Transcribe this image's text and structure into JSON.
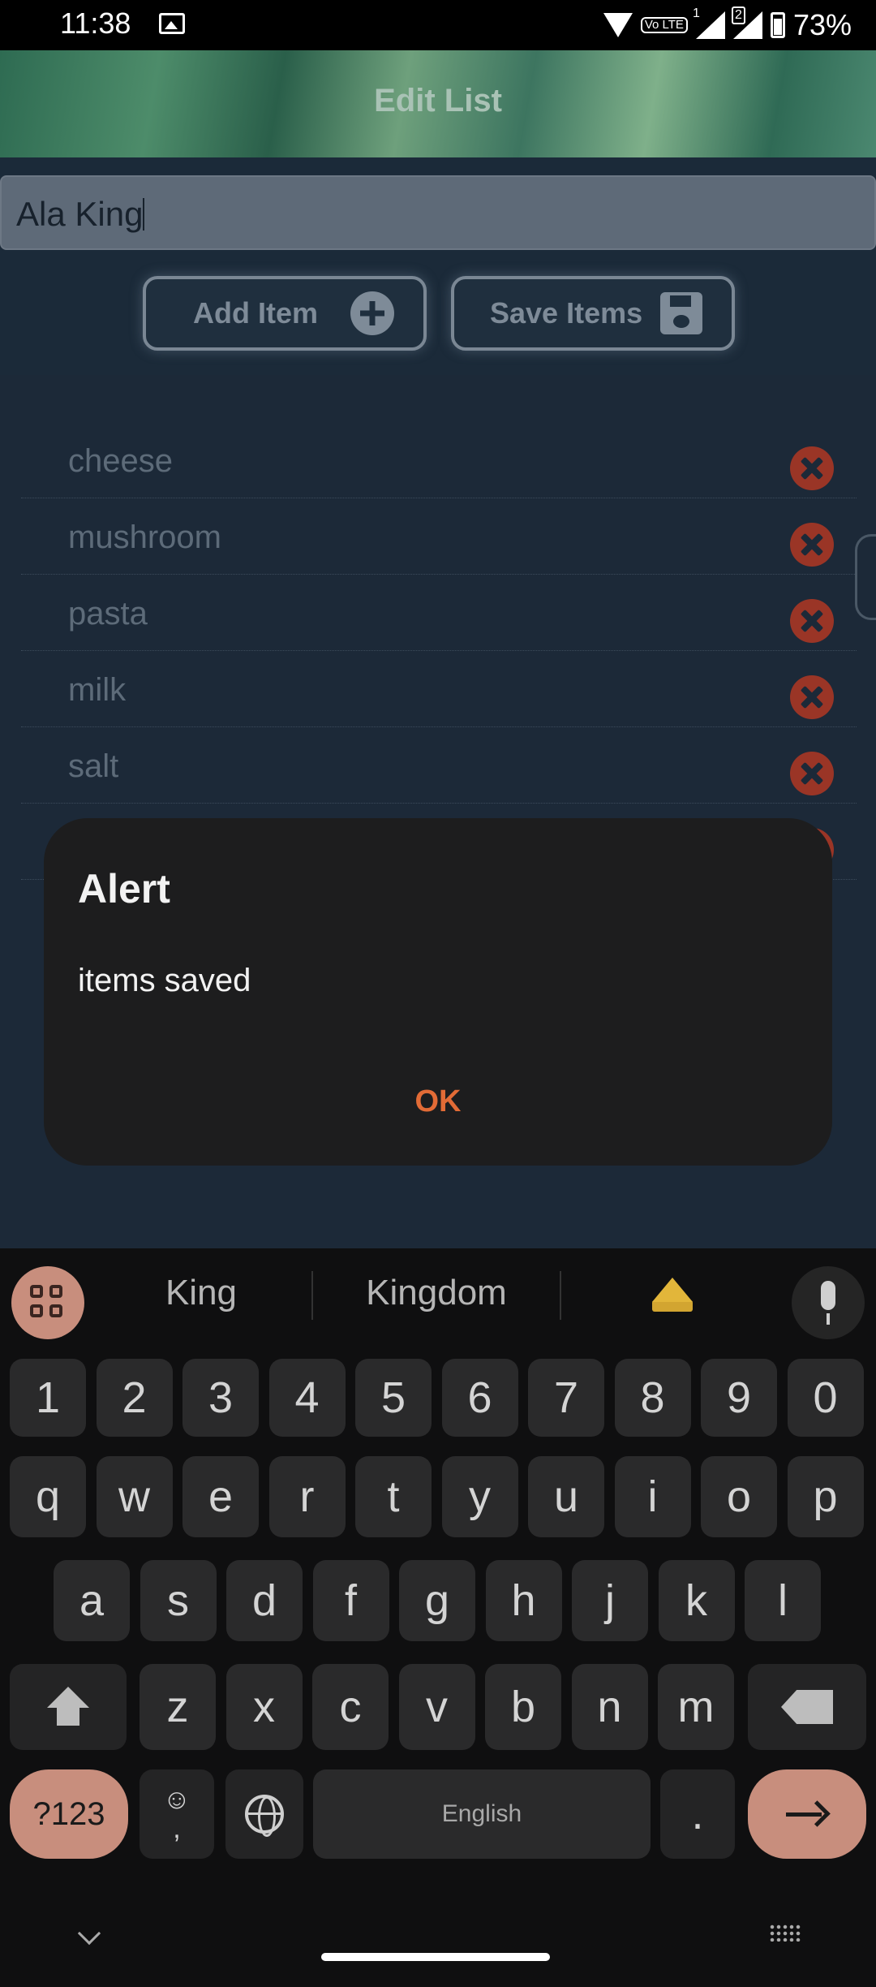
{
  "status_bar": {
    "time": "11:38",
    "sim1": "1",
    "sim2": "2",
    "volte": "Vo LTE",
    "battery": "73%"
  },
  "header": {
    "title": "Edit List"
  },
  "input": {
    "value": "Ala King"
  },
  "buttons": {
    "add_label": "Add Item",
    "save_label": "Save Items"
  },
  "list": {
    "items": [
      {
        "label": "cheese"
      },
      {
        "label": "mushroom"
      },
      {
        "label": "pasta"
      },
      {
        "label": "milk"
      },
      {
        "label": "salt"
      }
    ]
  },
  "dialog": {
    "title": "Alert",
    "message": "items saved",
    "ok_label": "OK"
  },
  "keyboard": {
    "suggestions": [
      "King",
      "Kingdom"
    ],
    "suggestion_emoji": "crown-icon",
    "row_numbers": [
      "1",
      "2",
      "3",
      "4",
      "5",
      "6",
      "7",
      "8",
      "9",
      "0"
    ],
    "row_1": [
      "q",
      "w",
      "e",
      "r",
      "t",
      "y",
      "u",
      "i",
      "o",
      "p"
    ],
    "row_2": [
      "a",
      "s",
      "d",
      "f",
      "g",
      "h",
      "j",
      "k",
      "l"
    ],
    "row_3": [
      "z",
      "x",
      "c",
      "v",
      "b",
      "n",
      "m"
    ],
    "symbols_label": "?123",
    "emoji_comma_label": "☺\n,",
    "space_label": "English",
    "period_label": "."
  },
  "colors": {
    "accent": "#c88e7d",
    "delete": "#9a3526",
    "dialog_ok": "#e26b36"
  }
}
